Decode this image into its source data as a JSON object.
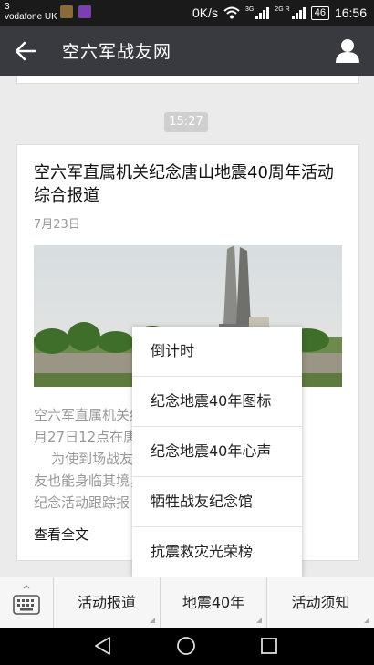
{
  "status_bar": {
    "carrier_line1": "3",
    "carrier_line2": "vodafone UK",
    "net_speed": "0K/s",
    "sim1_label": "3G",
    "sim2_label": "2G",
    "roaming_label": "R",
    "battery": "46",
    "time": "16:56"
  },
  "navbar": {
    "title": "空六军战友网"
  },
  "chat": {
    "time_label": "15:27",
    "article": {
      "title": "空六军直属机关纪念唐山地震40周年活动综合报道",
      "date": "7月23日",
      "summary_lines": [
        "空六军直属机关纪念活动将于7",
        "月27日12点在唐",
        "    为使到场战友和未能到场战",
        "友也能身临其境，从今天开始对",
        "纪念活动跟踪报"
      ],
      "read_all": "查看全文"
    }
  },
  "popup_menu": {
    "items": [
      "倒计时",
      "纪念地震40年图标",
      "纪念地震40年心声",
      "牺牲战友纪念馆",
      "抗震救灾光荣榜"
    ]
  },
  "bottom_menu": {
    "tabs": [
      "活动报道",
      "地震40年",
      "活动须知"
    ]
  }
}
